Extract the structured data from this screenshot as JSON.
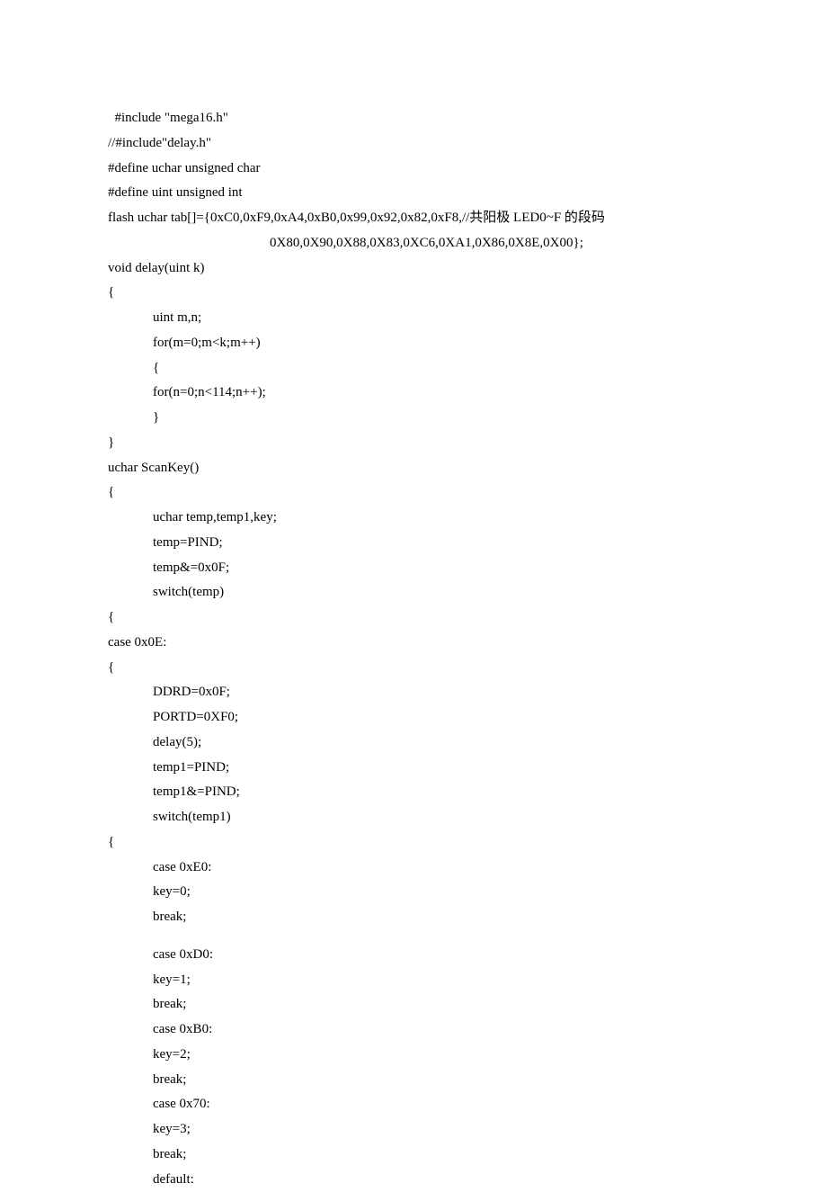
{
  "lines": [
    {
      "indent": 0,
      "text": "  #include \"mega16.h\""
    },
    {
      "indent": 0,
      "text": "//#include\"delay.h\""
    },
    {
      "indent": 0,
      "text": "#define uchar unsigned char"
    },
    {
      "indent": 0,
      "text": "#define uint unsigned int"
    },
    {
      "indent": 0,
      "text": "flash uchar tab[]={0xC0,0xF9,0xA4,0xB0,0x99,0x92,0x82,0xF8,//共阳极 LED0~F 的段码"
    },
    {
      "indent": 0,
      "text": "                                                0X80,0X90,0X88,0X83,0XC6,0XA1,0X86,0X8E,0X00};"
    },
    {
      "indent": 0,
      "text": "void delay(uint k)"
    },
    {
      "indent": 0,
      "text": "{"
    },
    {
      "indent": 1,
      "text": "uint m,n;"
    },
    {
      "indent": 1,
      "text": "for(m=0;m<k;m++)"
    },
    {
      "indent": 1,
      "text": "{"
    },
    {
      "indent": 1,
      "text": "for(n=0;n<114;n++);"
    },
    {
      "indent": 1,
      "text": "}"
    },
    {
      "indent": 0,
      "text": "}"
    },
    {
      "indent": 0,
      "text": "uchar ScanKey()"
    },
    {
      "indent": 0,
      "text": "{"
    },
    {
      "indent": 1,
      "text": "uchar temp,temp1,key;"
    },
    {
      "indent": 1,
      "text": "temp=PIND;"
    },
    {
      "indent": 1,
      "text": "temp&=0x0F;"
    },
    {
      "indent": 1,
      "text": "switch(temp)"
    },
    {
      "indent": 0,
      "text": "{"
    },
    {
      "indent": 0,
      "text": "case 0x0E:"
    },
    {
      "indent": 0,
      "text": "{"
    },
    {
      "indent": 1,
      "text": "DDRD=0x0F;"
    },
    {
      "indent": 1,
      "text": "PORTD=0XF0;"
    },
    {
      "indent": 1,
      "text": "delay(5);"
    },
    {
      "indent": 1,
      "text": "temp1=PIND;"
    },
    {
      "indent": 1,
      "text": "temp1&=PIND;"
    },
    {
      "indent": 1,
      "text": "switch(temp1)"
    },
    {
      "indent": 0,
      "text": "{"
    },
    {
      "indent": 1,
      "text": "case 0xE0:"
    },
    {
      "indent": 1,
      "text": "key=0;"
    },
    {
      "indent": 1,
      "text": "break;"
    },
    {
      "indent": -1,
      "text": ""
    },
    {
      "indent": 1,
      "text": "case 0xD0:"
    },
    {
      "indent": 1,
      "text": "key=1;"
    },
    {
      "indent": 1,
      "text": "break;"
    },
    {
      "indent": 1,
      "text": "case 0xB0:"
    },
    {
      "indent": 1,
      "text": "key=2;"
    },
    {
      "indent": 1,
      "text": "break;"
    },
    {
      "indent": 1,
      "text": "case 0x70:"
    },
    {
      "indent": 1,
      "text": "key=3;"
    },
    {
      "indent": 1,
      "text": "break;"
    },
    {
      "indent": 1,
      "text": "default:"
    }
  ]
}
